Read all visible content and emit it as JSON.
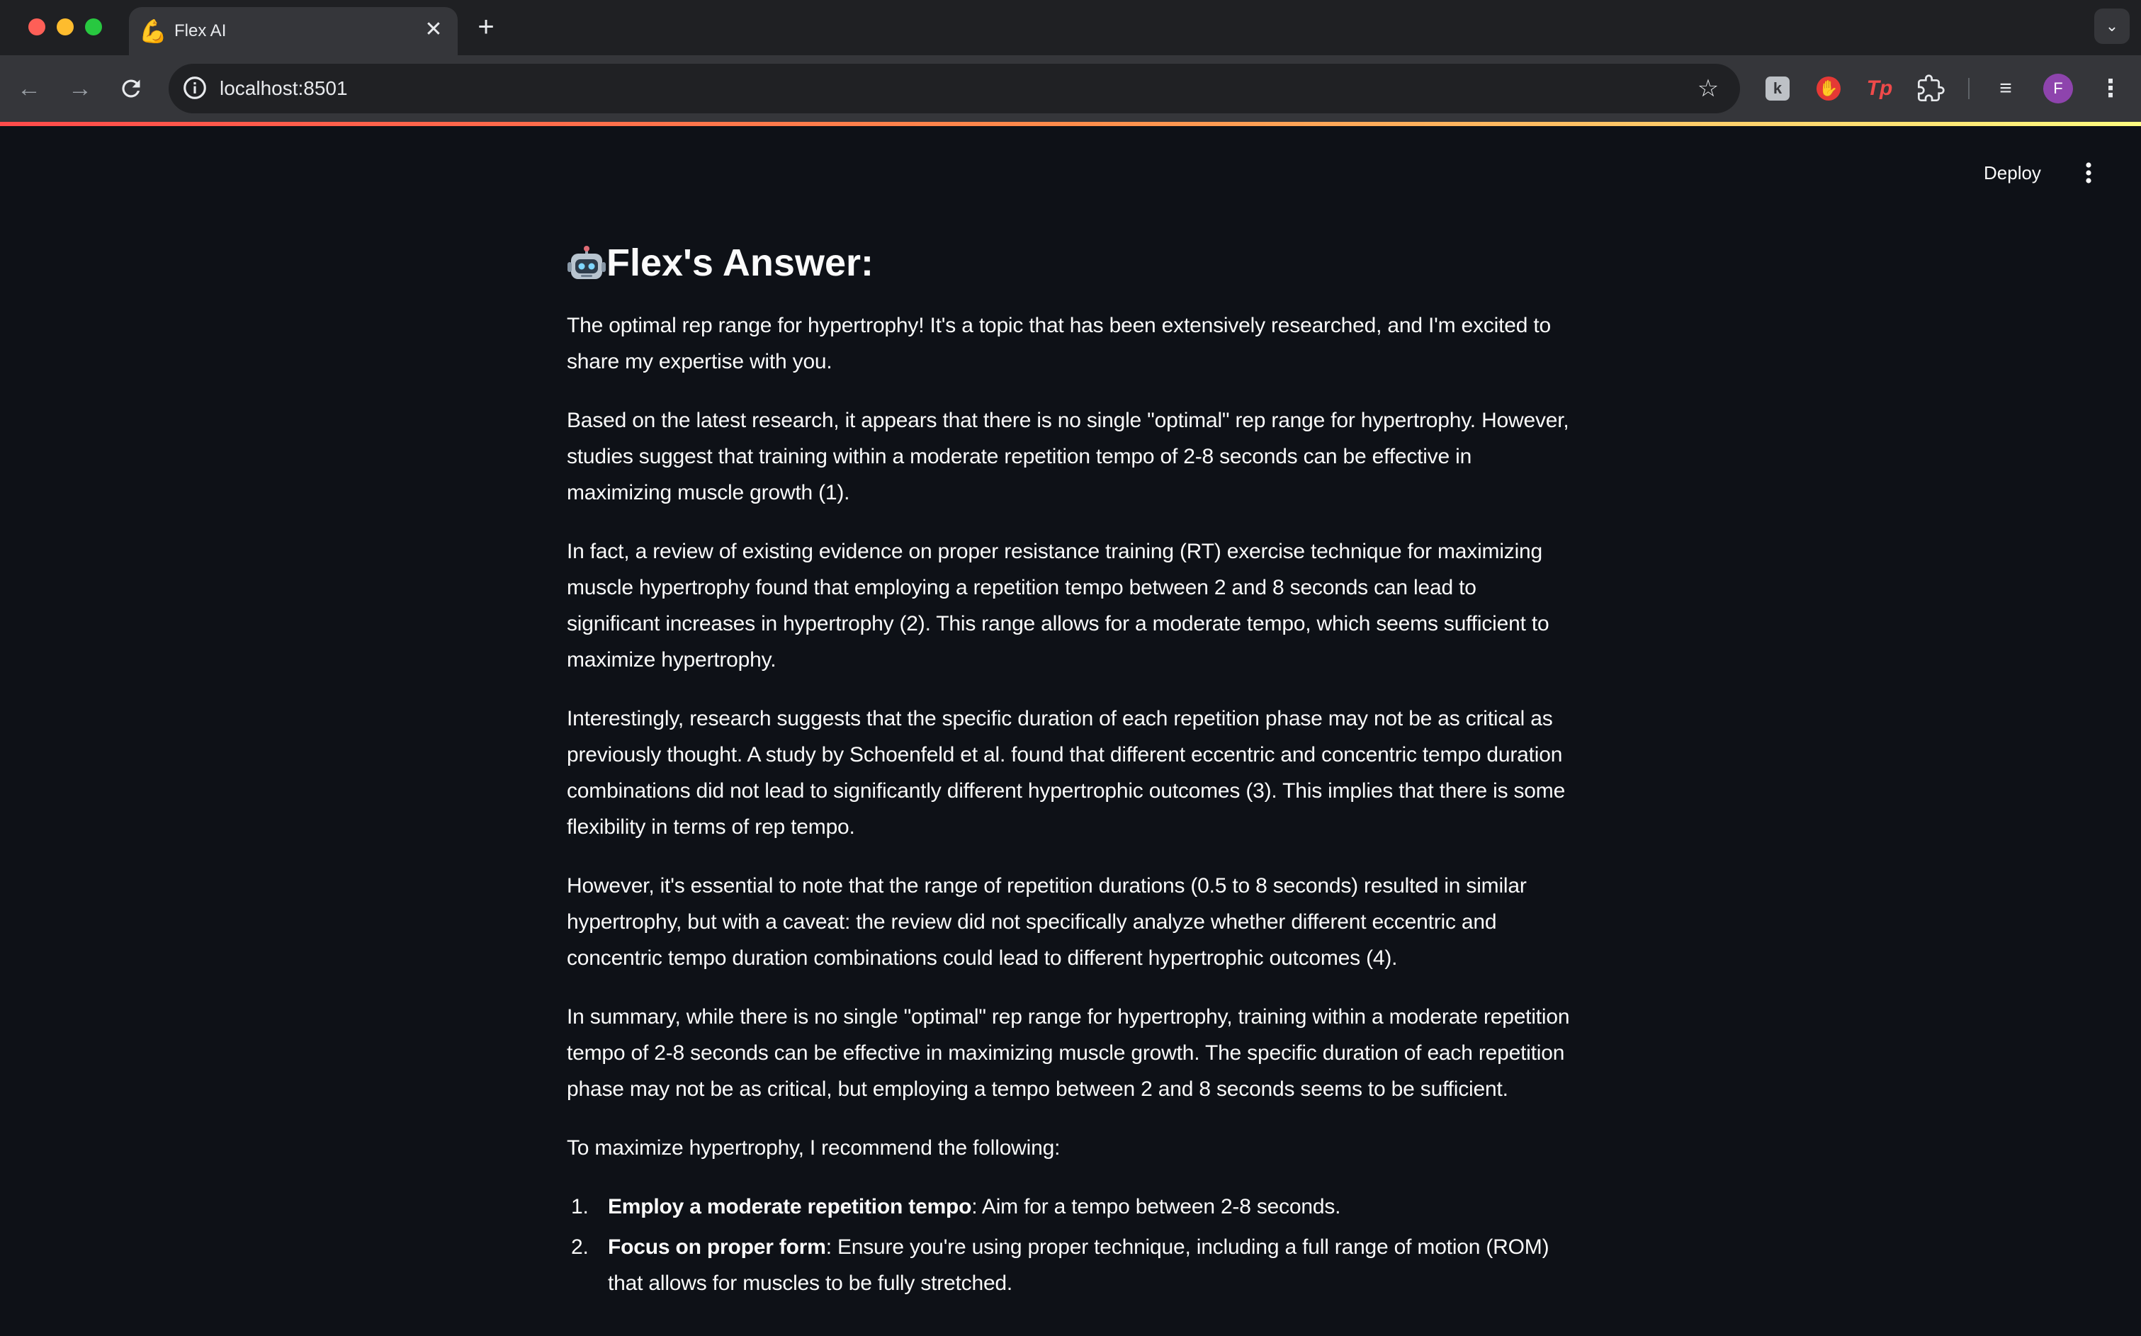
{
  "browser": {
    "tab_icon": "💪",
    "tab_title": "Flex AI",
    "url": "localhost:8501"
  },
  "app": {
    "deploy_label": "Deploy"
  },
  "answer": {
    "title_icon": "🤖",
    "title": "Flex's Answer:",
    "paragraphs": [
      "The optimal rep range for hypertrophy! It's a topic that has been extensively researched, and I'm excited to share my expertise with you.",
      "Based on the latest research, it appears that there is no single \"optimal\" rep range for hypertrophy. However, studies suggest that training within a moderate repetition tempo of 2-8 seconds can be effective in maximizing muscle growth (1).",
      "In fact, a review of existing evidence on proper resistance training (RT) exercise technique for maximizing muscle hypertrophy found that employing a repetition tempo between 2 and 8 seconds can lead to significant increases in hypertrophy (2). This range allows for a moderate tempo, which seems sufficient to maximize hypertrophy.",
      "Interestingly, research suggests that the specific duration of each repetition phase may not be as critical as previously thought. A study by Schoenfeld et al. found that different eccentric and concentric tempo duration combinations did not lead to significantly different hypertrophic outcomes (3). This implies that there is some flexibility in terms of rep tempo.",
      "However, it's essential to note that the range of repetition durations (0.5 to 8 seconds) resulted in similar hypertrophy, but with a caveat: the review did not specifically analyze whether different eccentric and concentric tempo duration combinations could lead to different hypertrophic outcomes (4).",
      "In summary, while there is no single \"optimal\" rep range for hypertrophy, training within a moderate repetition tempo of 2-8 seconds can be effective in maximizing muscle growth. The specific duration of each repetition phase may not be as critical, but employing a tempo between 2 and 8 seconds seems to be sufficient.",
      "To maximize hypertrophy, I recommend the following:"
    ],
    "recommendations": [
      {
        "number": "1.",
        "bold": "Employ a moderate repetition tempo",
        "text": ": Aim for a tempo between 2-8 seconds."
      },
      {
        "number": "2.",
        "bold": "Focus on proper form",
        "text": ": Ensure you're using proper technique, including a full range of motion (ROM) that allows for muscles to be fully stretched."
      }
    ]
  }
}
